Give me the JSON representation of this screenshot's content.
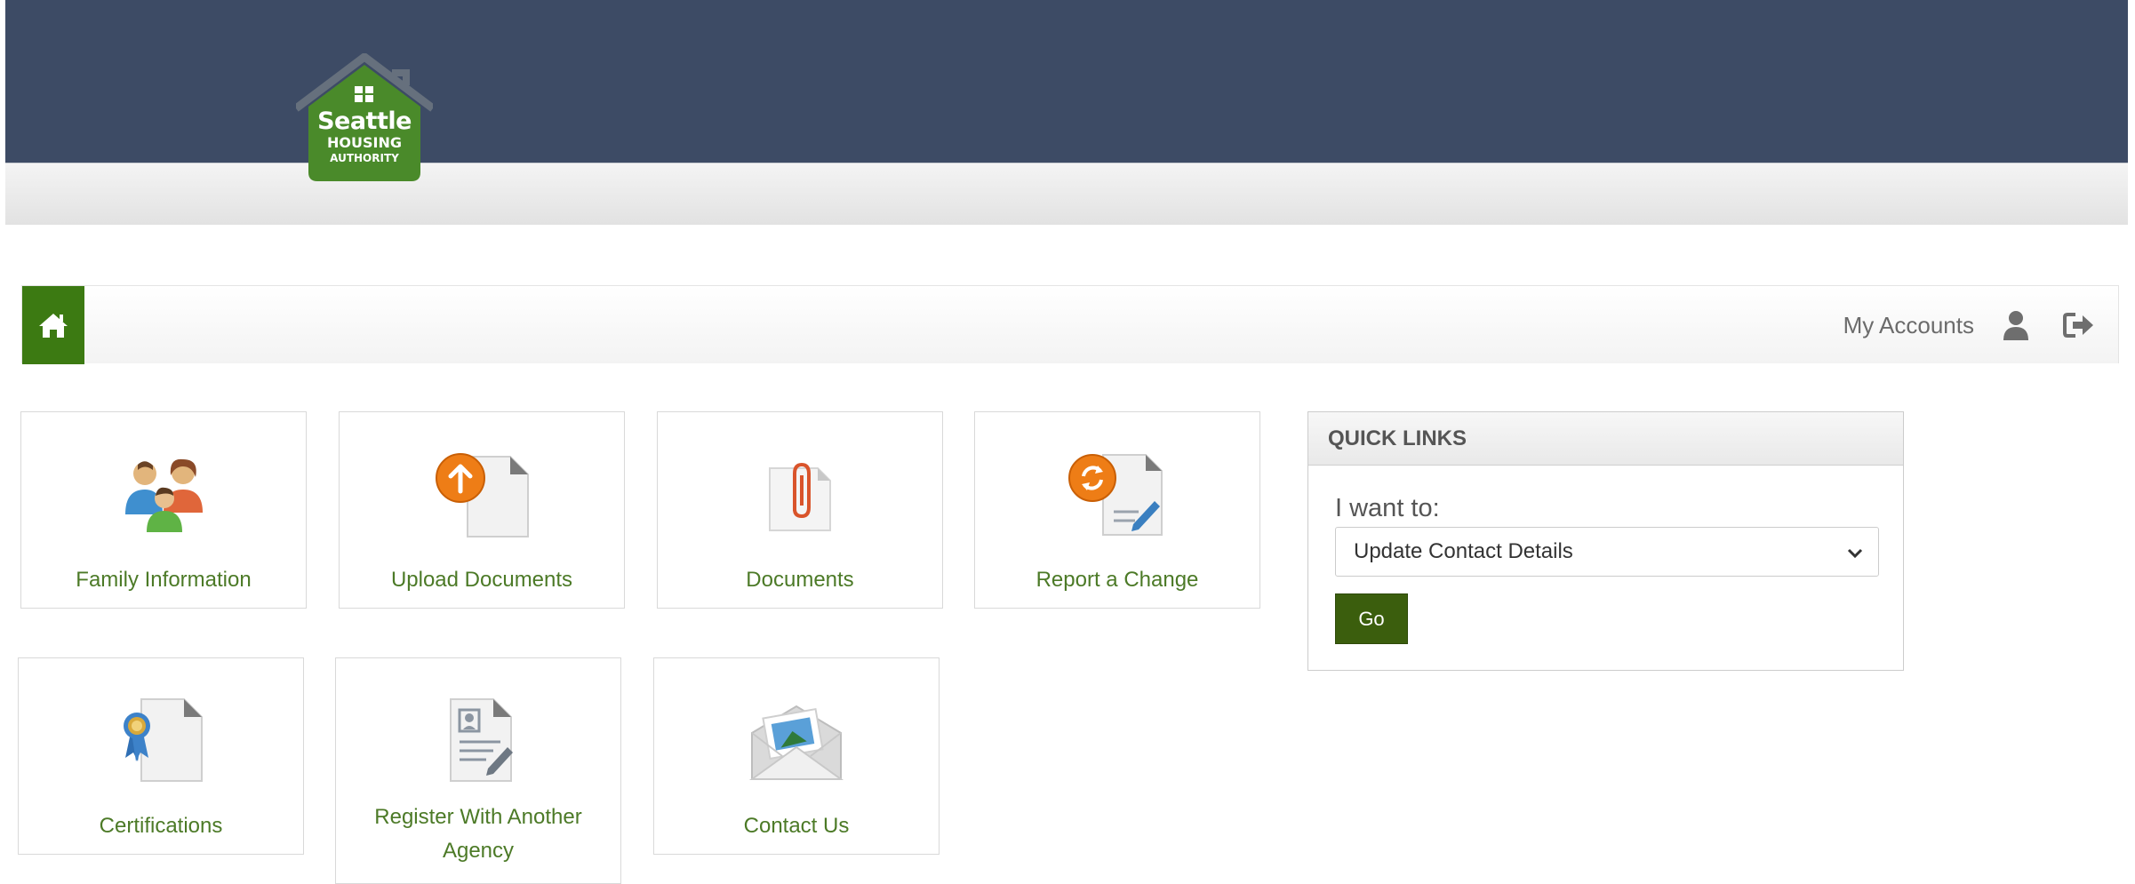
{
  "header": {
    "logo": {
      "line1": "Seattle",
      "line2": "HOUSING",
      "line3": "AUTHORITY"
    },
    "banner_color": "#3d4b65",
    "brand_green": "#4a8a2a"
  },
  "nav": {
    "home_icon": "home-icon",
    "my_accounts": "My Accounts",
    "user_icon": "user-icon",
    "logout_icon": "logout-icon"
  },
  "tiles": [
    {
      "label": "Family Information",
      "icon": "family-icon"
    },
    {
      "label": "Upload Documents",
      "icon": "upload-document-icon"
    },
    {
      "label": "Documents",
      "icon": "paperclip-document-icon"
    },
    {
      "label": "Report a Change",
      "icon": "report-change-icon"
    },
    {
      "label": "Certifications",
      "icon": "certificate-icon"
    },
    {
      "label": "Register With Another Agency",
      "icon": "register-form-icon"
    },
    {
      "label": "Contact Us",
      "icon": "envelope-icon"
    }
  ],
  "quick_links": {
    "title": "QUICK LINKS",
    "prompt": "I want to:",
    "selected_option": "Update Contact Details",
    "go_label": "Go"
  },
  "colors": {
    "tile_text": "#4c7a27",
    "home_button": "#3c7a12",
    "go_button": "#3b5e0d"
  }
}
